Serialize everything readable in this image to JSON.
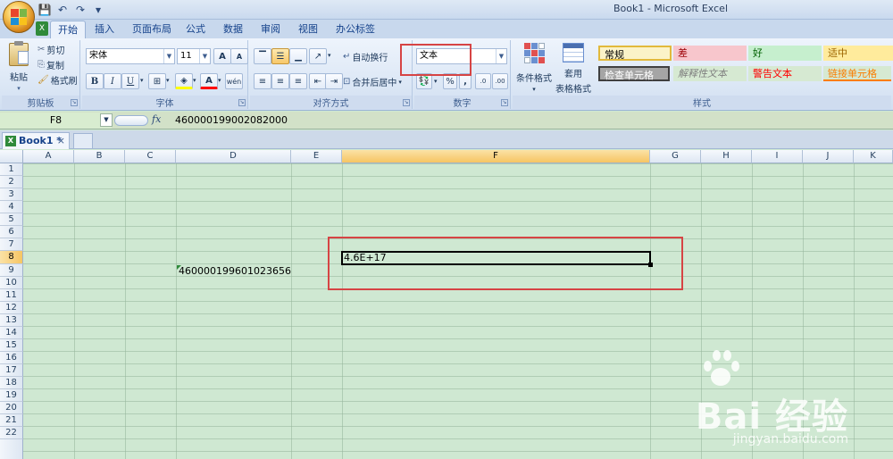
{
  "window": {
    "title": "Book1 - Microsoft Excel"
  },
  "ribbon_tabs": [
    "开始",
    "插入",
    "页面布局",
    "公式",
    "数据",
    "审阅",
    "视图",
    "办公标签"
  ],
  "clipboard": {
    "paste": "粘贴",
    "cut": "剪切",
    "copy": "复制",
    "format_painter": "格式刷",
    "label": "剪贴板"
  },
  "font": {
    "name": "宋体",
    "size": "11",
    "bold": "B",
    "italic": "I",
    "underline": "U",
    "grow": "A",
    "shrink": "A",
    "label": "字体",
    "wen": "wén"
  },
  "alignment": {
    "wrap": "自动换行",
    "merge": "合并后居中",
    "label": "对齐方式"
  },
  "number": {
    "format": "文本",
    "percent": "%",
    "comma": ",",
    "inc": ".0",
    "dec": ".00",
    "label": "数字"
  },
  "styles_group": {
    "cond_format": "条件格式",
    "table_format_1": "套用",
    "table_format_2": "表格格式",
    "label": "样式",
    "cells": [
      {
        "text": "常规",
        "bg": "#fbf3c8",
        "color": "#000000"
      },
      {
        "text": "差",
        "bg": "#f7c6cc",
        "color": "#9c0006"
      },
      {
        "text": "好",
        "bg": "#c6efce",
        "color": "#006100"
      },
      {
        "text": "适中",
        "bg": "#ffeb9c",
        "color": "#9c6500"
      },
      {
        "text": "检查单元格",
        "bg": "#a5a5a5",
        "color": "#ffffff"
      },
      {
        "text": "解释性文本",
        "bg": "#d6e9d2",
        "color": "#7f7f7f"
      },
      {
        "text": "警告文本",
        "bg": "#d6e9d2",
        "color": "#ff0000"
      },
      {
        "text": "链接单元格",
        "bg": "#d6e9d2",
        "color": "#fa7d00"
      }
    ]
  },
  "formula_bar": {
    "cell_ref": "F8",
    "fx": "fx",
    "content": "460000199002082000"
  },
  "workbook_tab": {
    "name": "Book1 *",
    "close": "×"
  },
  "columns": [
    "A",
    "B",
    "C",
    "D",
    "E",
    "F",
    "G",
    "H",
    "I",
    "J",
    "K"
  ],
  "rows": [
    "1",
    "2",
    "3",
    "4",
    "5",
    "6",
    "7",
    "8",
    "9",
    "10",
    "11",
    "12",
    "13",
    "14",
    "15",
    "16",
    "17",
    "18",
    "19",
    "20",
    "21",
    "22"
  ],
  "cells": {
    "d9": "460000199601023656",
    "f8": "4.6E+17"
  },
  "watermark": {
    "brand": "Bai  经验",
    "du": "du",
    "url": "jingyan.baidu.com"
  },
  "colors": {
    "selection_highlight": "#f6c563",
    "annotation_red": "#d64444",
    "sheet_bg": "#cfe8d2"
  }
}
